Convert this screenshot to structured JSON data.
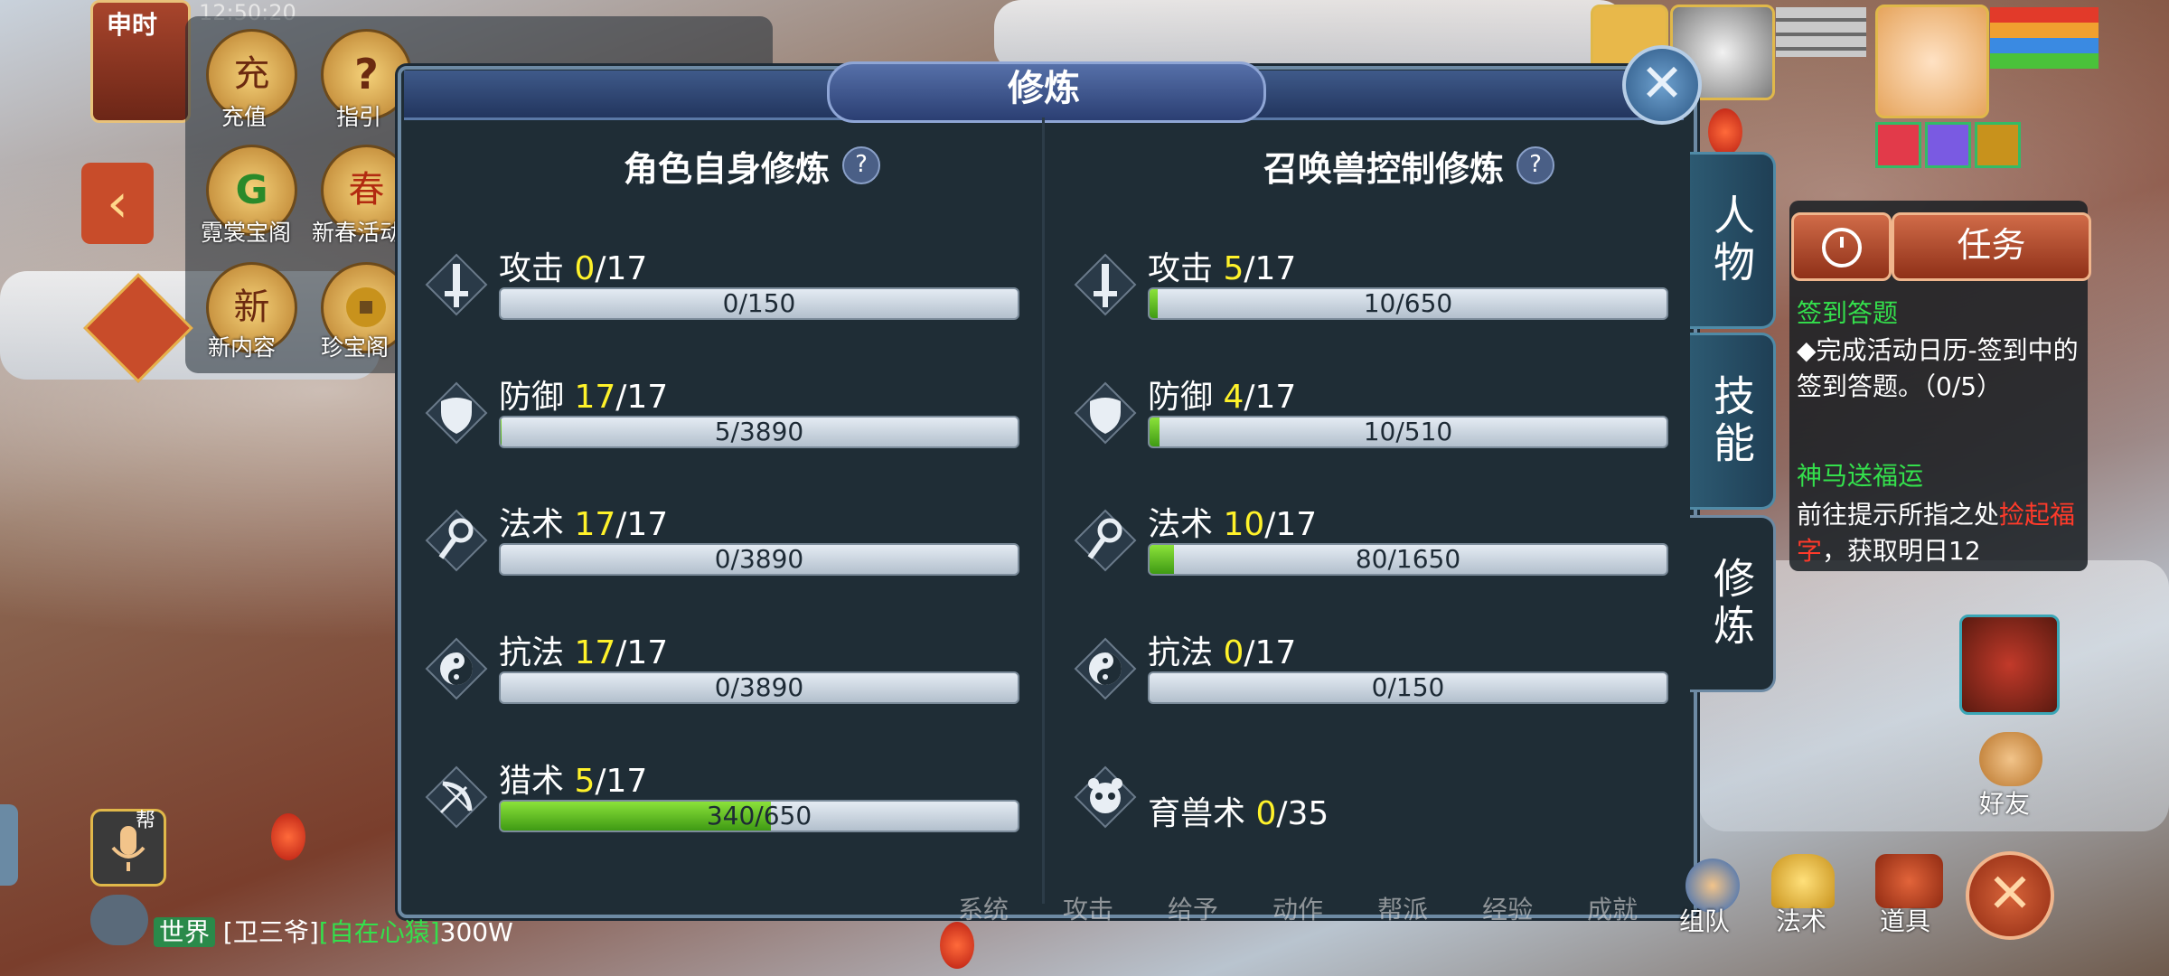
{
  "hud": {
    "clock": "申时",
    "time": "12:50:20",
    "buttons": [
      "充值",
      "指引",
      "霓裳宝阁",
      "新春活动",
      "新内容",
      "珍宝阁"
    ],
    "recharge_icon_char": "充",
    "guide_icon_char": "?",
    "treasure_icon_char": "G",
    "spring_icon_char": "春",
    "new_icon_char": "新"
  },
  "modal": {
    "title": "修炼",
    "close": "✕",
    "left_title": "角色自身修炼",
    "right_title": "召唤兽控制修炼",
    "help": "?"
  },
  "left_rows": [
    {
      "name": "攻击",
      "level": "0",
      "max": "/17",
      "progress_text": "0/150",
      "fill": 0.0
    },
    {
      "name": "防御",
      "level": "17",
      "max": "/17",
      "progress_text": "5/3890",
      "fill": 0.0013
    },
    {
      "name": "法术",
      "level": "17",
      "max": "/17",
      "progress_text": "0/3890",
      "fill": 0.0
    },
    {
      "name": "抗法",
      "level": "17",
      "max": "/17",
      "progress_text": "0/3890",
      "fill": 0.0
    },
    {
      "name": "猎术",
      "level": "5",
      "max": "/17",
      "progress_text": "340/650",
      "fill": 0.523
    }
  ],
  "right_rows": [
    {
      "name": "攻击",
      "level": "5",
      "max": "/17",
      "progress_text": "10/650",
      "fill": 0.015
    },
    {
      "name": "防御",
      "level": "4",
      "max": "/17",
      "progress_text": "10/510",
      "fill": 0.02
    },
    {
      "name": "法术",
      "level": "10",
      "max": "/17",
      "progress_text": "80/1650",
      "fill": 0.048
    },
    {
      "name": "抗法",
      "level": "0",
      "max": "/17",
      "progress_text": "0/150",
      "fill": 0.0
    },
    {
      "name": "育兽术",
      "level": "0",
      "max": "/35"
    }
  ],
  "tabs": [
    "人物",
    "技能",
    "修炼"
  ],
  "quests": {
    "task_label": "任务",
    "q1_title": "签到答题",
    "q1_body": "◆完成活动日历-签到中的签到答题。（0/5）",
    "q2_title": "神马送福运",
    "q2_body_a": "前往提示所指之处",
    "q2_body_red": "捡起福字",
    "q2_body_b": "，获取明日12"
  },
  "bottom": {
    "friends": "好友",
    "team": "组队",
    "magic": "法术",
    "items": "道具",
    "hidden_menu": [
      "系统",
      "攻击",
      "给予",
      "动作",
      "帮派",
      "经验",
      "成就"
    ]
  },
  "chat": {
    "channel": "世界",
    "speaker": "[卫三爷]",
    "message_green": "[自在心猿]",
    "message": "300W",
    "voice_label": "帮"
  },
  "colors": {
    "level_yellow": "#fff22a",
    "bar_green": "#5cc020",
    "modal_bg": "#1f2d36"
  }
}
